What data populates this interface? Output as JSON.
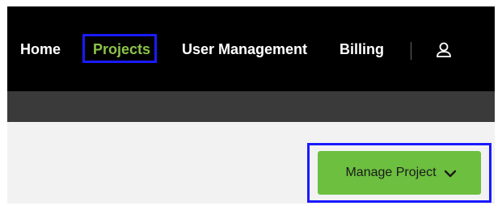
{
  "nav": {
    "home": "Home",
    "projects": "Projects",
    "user_management": "User Management",
    "billing": "Billing",
    "user_icon": "user-icon",
    "active_color": "#8bc34a"
  },
  "actions": {
    "manage_project": "Manage Project",
    "manage_project_icon": "chevron-down-icon",
    "button_color": "#6cbf3f"
  },
  "annotations": {
    "highlight_color": "#1a1aff"
  }
}
